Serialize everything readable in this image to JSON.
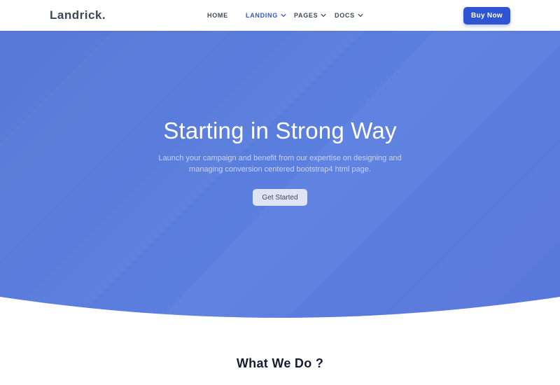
{
  "header": {
    "logo": "Landrick.",
    "nav": [
      {
        "label": "HOME",
        "active": false,
        "dropdown": false
      },
      {
        "label": "LANDING",
        "active": true,
        "dropdown": true
      },
      {
        "label": "PAGES",
        "active": false,
        "dropdown": true
      },
      {
        "label": "DOCS",
        "active": false,
        "dropdown": true
      }
    ],
    "buy_label": "Buy Now"
  },
  "hero": {
    "title": "Starting in Strong Way",
    "subtitle_line1": "Launch your campaign and benefit from our expertise on designing and",
    "subtitle_line2": "managing conversion centered bootstrap4 html page.",
    "cta_label": "Get Started"
  },
  "section": {
    "title": "What We Do ?"
  },
  "colors": {
    "primary": "#2f55d4",
    "hero_bg": "#5a7cdc",
    "text_dark": "#3c4858"
  },
  "icons": {
    "dropdown": "chevron-down-icon"
  }
}
